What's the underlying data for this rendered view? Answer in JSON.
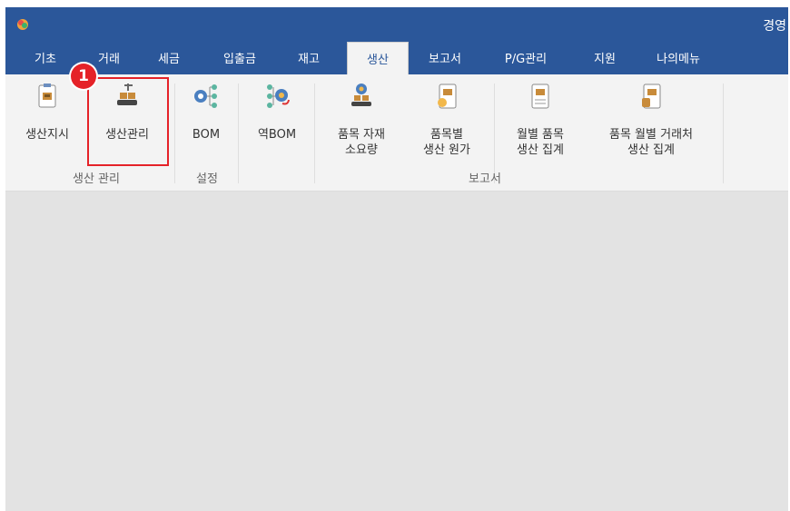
{
  "window": {
    "title": "경영"
  },
  "tabs": [
    {
      "label": "기초"
    },
    {
      "label": "거래"
    },
    {
      "label": "세금"
    },
    {
      "label": "입출금"
    },
    {
      "label": "재고"
    },
    {
      "label": "생산",
      "active": true
    },
    {
      "label": "보고서"
    },
    {
      "label": "P/G관리"
    },
    {
      "label": "지원"
    },
    {
      "label": "나의메뉴"
    }
  ],
  "ribbon": {
    "buttons": {
      "production_order": "생산지시",
      "production_manage": "생산관리",
      "bom": "BOM",
      "reverse_bom": "역BOM",
      "material_usage": "품목 자재\n소요량",
      "production_cost": "품목별\n생산 원가",
      "monthly_summary": "월별 품목\n생산 집계",
      "monthly_vendor_summary": "품목 월별 거래처\n생산 집계"
    },
    "groups": {
      "production_manage": "생산 관리",
      "settings": "설정",
      "report": "보고서"
    }
  },
  "annotation": {
    "step_number": "1"
  },
  "colors": {
    "accent": "#2b579a",
    "highlight": "#e52228",
    "workspace": "#e3e3e3"
  }
}
